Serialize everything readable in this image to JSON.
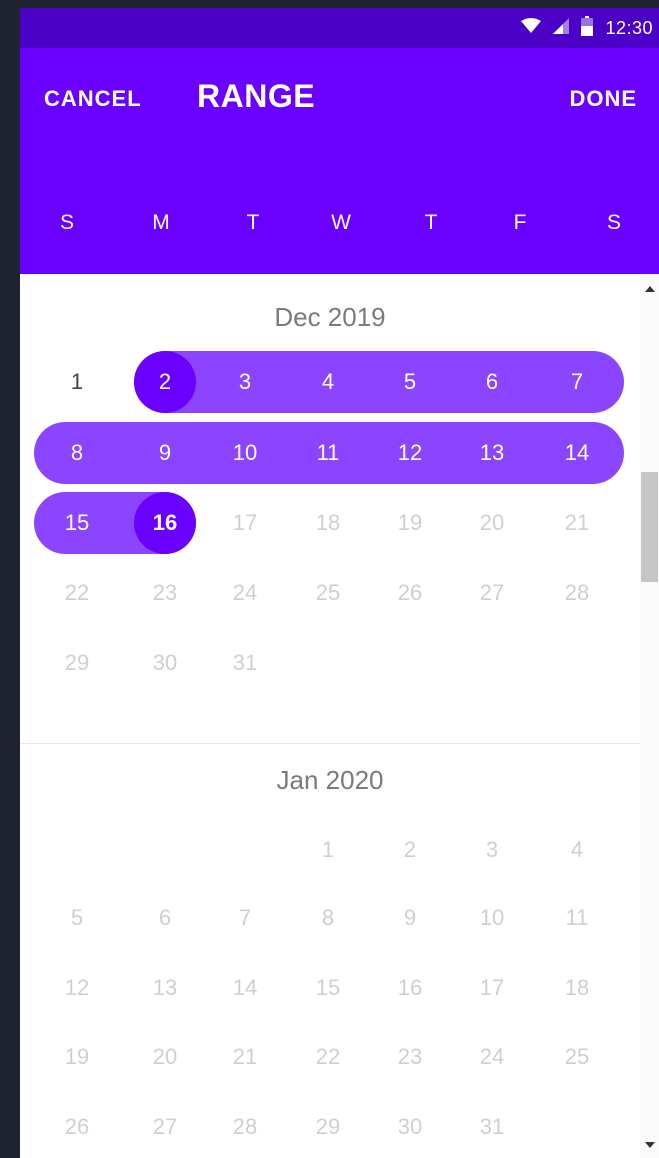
{
  "status_bar": {
    "time": "12:30",
    "icons": [
      "wifi-icon",
      "signal-icon",
      "battery-icon"
    ]
  },
  "app_bar": {
    "cancel_label": "CANCEL",
    "title": "RANGE",
    "done_label": "DONE"
  },
  "weekdays": [
    "S",
    "M",
    "T",
    "W",
    "T",
    "F",
    "S"
  ],
  "calendar": {
    "selected_range": {
      "start": "Dec 2, 2019",
      "end": "Dec 16, 2019"
    },
    "months": [
      {
        "title": "Dec 2019",
        "weeks": [
          [
            "1",
            "2",
            "3",
            "4",
            "5",
            "6",
            "7"
          ],
          [
            "8",
            "9",
            "10",
            "11",
            "12",
            "13",
            "14"
          ],
          [
            "15",
            "16",
            "17",
            "18",
            "19",
            "20",
            "21"
          ],
          [
            "22",
            "23",
            "24",
            "25",
            "26",
            "27",
            "28"
          ],
          [
            "29",
            "30",
            "31",
            "",
            "",
            "",
            ""
          ]
        ]
      },
      {
        "title": "Jan 2020",
        "weeks": [
          [
            "",
            "",
            "",
            "1",
            "2",
            "3",
            "4"
          ],
          [
            "5",
            "6",
            "7",
            "8",
            "9",
            "10",
            "11"
          ],
          [
            "12",
            "13",
            "14",
            "15",
            "16",
            "17",
            "18"
          ],
          [
            "19",
            "20",
            "21",
            "22",
            "23",
            "24",
            "25"
          ],
          [
            "26",
            "27",
            "28",
            "29",
            "30",
            "31",
            ""
          ]
        ]
      }
    ]
  },
  "colors": {
    "status_bar": "#4b00c8",
    "primary": "#6a00ff",
    "range_fill": "#8c45ff",
    "disabled_text": "#cfcfcf",
    "enabled_text": "#444444"
  }
}
